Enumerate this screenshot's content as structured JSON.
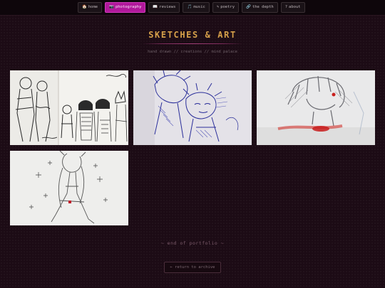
{
  "nav": {
    "items": [
      {
        "icon": "🏠",
        "icon_name": "home-icon",
        "label": "home",
        "active": false
      },
      {
        "icon": "📷",
        "icon_name": "camera-icon",
        "label": "photography",
        "active": true
      },
      {
        "icon": "📖",
        "icon_name": "book-icon",
        "label": "reviews",
        "active": false
      },
      {
        "icon": "🎵",
        "icon_name": "music-note-icon",
        "label": "music",
        "active": false
      },
      {
        "icon": "✎",
        "icon_name": "quill-icon",
        "label": "poetry",
        "active": false
      },
      {
        "icon": "🔗",
        "icon_name": "link-icon",
        "label": "the depth",
        "active": false
      },
      {
        "icon": "?",
        "icon_name": "question-icon",
        "label": "about",
        "active": false
      }
    ]
  },
  "header": {
    "title": "SKETCHES & ART",
    "subtitle": "hand drawn // creations // mind palace"
  },
  "gallery": {
    "items": [
      {
        "name": "sketch-1",
        "description": "pencil sketch of a group of anime characters"
      },
      {
        "name": "sketch-2",
        "description": "blue ballpoint pen sketch of anime characters"
      },
      {
        "name": "sketch-3",
        "description": "grey pencil sketch of a character with red accents"
      },
      {
        "name": "sketch-4",
        "description": "pencil sketch of a girl with long hair and sparkles"
      }
    ]
  },
  "footer": {
    "end_text": "~ end of portfolio ~",
    "return_label": "← return to archive"
  },
  "colors": {
    "background": "#1c0b15",
    "accent": "#b1189b",
    "title": "#d6a04a"
  }
}
